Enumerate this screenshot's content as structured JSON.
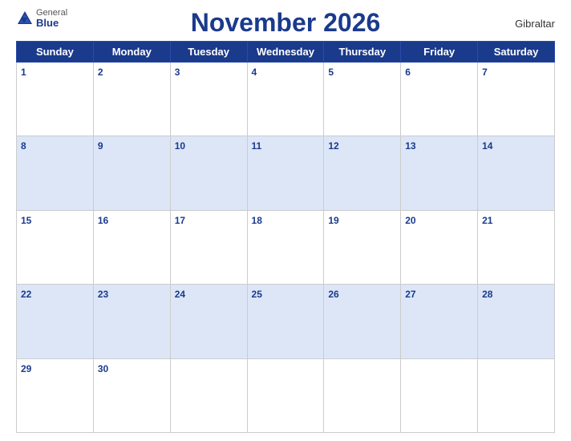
{
  "header": {
    "logo_general": "General",
    "logo_blue": "Blue",
    "title": "November 2026",
    "region": "Gibraltar"
  },
  "weekdays": [
    "Sunday",
    "Monday",
    "Tuesday",
    "Wednesday",
    "Thursday",
    "Friday",
    "Saturday"
  ],
  "weeks": [
    {
      "shaded": false,
      "days": [
        {
          "num": "1",
          "empty": false
        },
        {
          "num": "2",
          "empty": false
        },
        {
          "num": "3",
          "empty": false
        },
        {
          "num": "4",
          "empty": false
        },
        {
          "num": "5",
          "empty": false
        },
        {
          "num": "6",
          "empty": false
        },
        {
          "num": "7",
          "empty": false
        }
      ]
    },
    {
      "shaded": true,
      "days": [
        {
          "num": "8",
          "empty": false
        },
        {
          "num": "9",
          "empty": false
        },
        {
          "num": "10",
          "empty": false
        },
        {
          "num": "11",
          "empty": false
        },
        {
          "num": "12",
          "empty": false
        },
        {
          "num": "13",
          "empty": false
        },
        {
          "num": "14",
          "empty": false
        }
      ]
    },
    {
      "shaded": false,
      "days": [
        {
          "num": "15",
          "empty": false
        },
        {
          "num": "16",
          "empty": false
        },
        {
          "num": "17",
          "empty": false
        },
        {
          "num": "18",
          "empty": false
        },
        {
          "num": "19",
          "empty": false
        },
        {
          "num": "20",
          "empty": false
        },
        {
          "num": "21",
          "empty": false
        }
      ]
    },
    {
      "shaded": true,
      "days": [
        {
          "num": "22",
          "empty": false
        },
        {
          "num": "23",
          "empty": false
        },
        {
          "num": "24",
          "empty": false
        },
        {
          "num": "25",
          "empty": false
        },
        {
          "num": "26",
          "empty": false
        },
        {
          "num": "27",
          "empty": false
        },
        {
          "num": "28",
          "empty": false
        }
      ]
    },
    {
      "shaded": false,
      "days": [
        {
          "num": "29",
          "empty": false
        },
        {
          "num": "30",
          "empty": false
        },
        {
          "num": "",
          "empty": true
        },
        {
          "num": "",
          "empty": true
        },
        {
          "num": "",
          "empty": true
        },
        {
          "num": "",
          "empty": true
        },
        {
          "num": "",
          "empty": true
        }
      ]
    }
  ]
}
